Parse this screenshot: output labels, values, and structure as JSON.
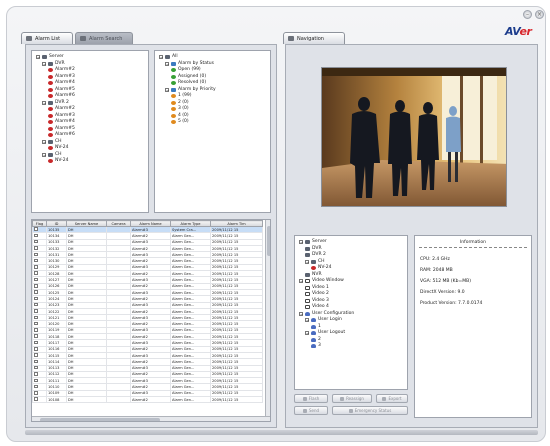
{
  "window": {
    "min_glyph": "–",
    "close_glyph": "×"
  },
  "brand": {
    "logo_a": "AV",
    "logo_b": "er"
  },
  "tabs": {
    "alarm_list": "Alarm List",
    "alarm_search": "Alarm Search",
    "navigation": "Navigation"
  },
  "alarm_tree": {
    "root": "Server",
    "nodes": [
      {
        "level": 1,
        "label": "DVR",
        "icon": "server-icon"
      },
      {
        "level": 2,
        "label": "Alarm#2",
        "icon": "alarm-icon"
      },
      {
        "level": 2,
        "label": "Alarm#3",
        "icon": "alarm-icon"
      },
      {
        "level": 2,
        "label": "Alarm#4",
        "icon": "alarm-icon"
      },
      {
        "level": 2,
        "label": "Alarm#5",
        "icon": "alarm-icon"
      },
      {
        "level": 2,
        "label": "Alarm#6",
        "icon": "alarm-icon"
      },
      {
        "level": 1,
        "label": "DVR 2",
        "icon": "server-icon"
      },
      {
        "level": 2,
        "label": "Alarm#2",
        "icon": "alarm-icon"
      },
      {
        "level": 2,
        "label": "Alarm#3",
        "icon": "alarm-icon"
      },
      {
        "level": 2,
        "label": "Alarm#4",
        "icon": "alarm-icon"
      },
      {
        "level": 2,
        "label": "Alarm#5",
        "icon": "alarm-icon"
      },
      {
        "level": 2,
        "label": "Alarm#6",
        "icon": "alarm-icon"
      },
      {
        "level": 1,
        "label": "CH",
        "icon": "server-icon"
      },
      {
        "level": 2,
        "label": "NV-24",
        "icon": "alarm-icon"
      },
      {
        "level": 1,
        "label": "CH",
        "icon": "server-icon"
      },
      {
        "level": 2,
        "label": "NV-24",
        "icon": "alarm-icon"
      }
    ]
  },
  "filter_tree": {
    "root": "All",
    "nodes": [
      {
        "level": 1,
        "label": "Alarm by Status",
        "icon": "group-icon"
      },
      {
        "level": 2,
        "label": "Open (99)",
        "icon": "status-icon"
      },
      {
        "level": 2,
        "label": "Assigned (0)",
        "icon": "status-icon"
      },
      {
        "level": 2,
        "label": "Resolved (0)",
        "icon": "status-icon"
      },
      {
        "level": 1,
        "label": "Alarm by Priority",
        "icon": "group-icon"
      },
      {
        "level": 2,
        "label": "1 (99)",
        "icon": "priority-icon"
      },
      {
        "level": 2,
        "label": "2 (0)",
        "icon": "priority-icon"
      },
      {
        "level": 2,
        "label": "3 (0)",
        "icon": "priority-icon"
      },
      {
        "level": 2,
        "label": "4 (0)",
        "icon": "priority-icon"
      },
      {
        "level": 2,
        "label": "5 (0)",
        "icon": "priority-icon"
      }
    ]
  },
  "alarm_table": {
    "columns": [
      "Flag",
      "ID",
      "Server Name",
      "Camera",
      "Alarm Name",
      "Alarm Type",
      "Alarm Tim"
    ],
    "rows": [
      [
        "",
        "10135",
        "DH",
        "",
        "Alarm#3",
        "System Cra...",
        "2009/11/12 15"
      ],
      [
        "",
        "10134",
        "DH",
        "",
        "Alarm#2",
        "Alarm Gen...",
        "2009/11/12 15"
      ],
      [
        "",
        "10133",
        "DH",
        "",
        "Alarm#3",
        "Alarm Gen...",
        "2009/11/12 15"
      ],
      [
        "",
        "10132",
        "DH",
        "",
        "Alarm#2",
        "Alarm Gen...",
        "2009/11/12 15"
      ],
      [
        "",
        "10131",
        "DH",
        "",
        "Alarm#3",
        "Alarm Gen...",
        "2009/11/12 15"
      ],
      [
        "",
        "10130",
        "DH",
        "",
        "Alarm#2",
        "Alarm Gen...",
        "2009/11/12 15"
      ],
      [
        "",
        "10129",
        "DH",
        "",
        "Alarm#3",
        "Alarm Gen...",
        "2009/11/12 15"
      ],
      [
        "",
        "10128",
        "DH",
        "",
        "Alarm#2",
        "Alarm Gen...",
        "2009/11/12 15"
      ],
      [
        "",
        "10127",
        "DH",
        "",
        "Alarm#3",
        "Alarm Gen...",
        "2009/11/12 15"
      ],
      [
        "",
        "10126",
        "DH",
        "",
        "Alarm#2",
        "Alarm Gen...",
        "2009/11/12 15"
      ],
      [
        "",
        "10125",
        "DH",
        "",
        "Alarm#3",
        "Alarm Gen...",
        "2009/11/12 15"
      ],
      [
        "",
        "10124",
        "DH",
        "",
        "Alarm#2",
        "Alarm Gen...",
        "2009/11/12 15"
      ],
      [
        "",
        "10123",
        "DH",
        "",
        "Alarm#3",
        "Alarm Gen...",
        "2009/11/12 15"
      ],
      [
        "",
        "10122",
        "DH",
        "",
        "Alarm#2",
        "Alarm Gen...",
        "2009/11/12 15"
      ],
      [
        "",
        "10121",
        "DH",
        "",
        "Alarm#3",
        "Alarm Gen...",
        "2009/11/12 15"
      ],
      [
        "",
        "10120",
        "DH",
        "",
        "Alarm#2",
        "Alarm Gen...",
        "2009/11/12 15"
      ],
      [
        "",
        "10119",
        "DH",
        "",
        "Alarm#3",
        "Alarm Gen...",
        "2009/11/12 15"
      ],
      [
        "",
        "10118",
        "DH",
        "",
        "Alarm#2",
        "Alarm Gen...",
        "2009/11/12 15"
      ],
      [
        "",
        "10117",
        "DH",
        "",
        "Alarm#3",
        "Alarm Gen...",
        "2009/11/12 15"
      ],
      [
        "",
        "10116",
        "DH",
        "",
        "Alarm#2",
        "Alarm Gen...",
        "2009/11/12 15"
      ],
      [
        "",
        "10115",
        "DH",
        "",
        "Alarm#3",
        "Alarm Gen...",
        "2009/11/12 15"
      ],
      [
        "",
        "10114",
        "DH",
        "",
        "Alarm#2",
        "Alarm Gen...",
        "2009/11/12 15"
      ],
      [
        "",
        "10113",
        "DH",
        "",
        "Alarm#3",
        "Alarm Gen...",
        "2009/11/12 15"
      ],
      [
        "",
        "10112",
        "DH",
        "",
        "Alarm#2",
        "Alarm Gen...",
        "2009/11/12 15"
      ],
      [
        "",
        "10111",
        "DH",
        "",
        "Alarm#3",
        "Alarm Gen...",
        "2009/11/12 15"
      ],
      [
        "",
        "10110",
        "DH",
        "",
        "Alarm#2",
        "Alarm Gen...",
        "2009/11/12 15"
      ],
      [
        "",
        "10109",
        "DH",
        "",
        "Alarm#3",
        "Alarm Gen...",
        "2009/11/12 15"
      ],
      [
        "",
        "10108",
        "DH",
        "",
        "Alarm#2",
        "Alarm Gen...",
        "2009/11/12 15"
      ]
    ]
  },
  "nav_tree": {
    "nodes": [
      {
        "level": 0,
        "label": "Server",
        "icon": "server-icon"
      },
      {
        "level": 1,
        "label": "DVR",
        "icon": "server-icon"
      },
      {
        "level": 1,
        "label": "DVR 2",
        "icon": "server-icon"
      },
      {
        "level": 1,
        "label": "CH",
        "icon": "server-icon"
      },
      {
        "level": 2,
        "label": "NV-24",
        "icon": "alarm-icon"
      },
      {
        "level": 1,
        "label": "NVR",
        "icon": "server-icon"
      },
      {
        "level": 0,
        "label": "Video Window",
        "icon": "window-icon"
      },
      {
        "level": 1,
        "label": "Video 1",
        "icon": "window-icon"
      },
      {
        "level": 1,
        "label": "Video 2",
        "icon": "window-icon"
      },
      {
        "level": 1,
        "label": "Video 3",
        "icon": "window-icon"
      },
      {
        "level": 1,
        "label": "Video 4",
        "icon": "window-icon"
      },
      {
        "level": 0,
        "label": "User Configuration",
        "icon": "user-icon"
      },
      {
        "level": 1,
        "label": "User Login",
        "icon": "user-icon"
      },
      {
        "level": 2,
        "label": "1",
        "icon": "user-icon"
      },
      {
        "level": 1,
        "label": "User Logout",
        "icon": "user-icon"
      },
      {
        "level": 2,
        "label": "2",
        "icon": "user-icon"
      },
      {
        "level": 2,
        "label": "3",
        "icon": "user-icon"
      }
    ]
  },
  "info": {
    "title": "Information",
    "rule": "==================================",
    "lines": [
      "CPU: 2.4 GHz",
      "RAM: 2048 MB",
      "VGA: 512 MB (Kb=MB)",
      "DirectX Version: 9.0",
      "Product Version: 7.7.0.0174"
    ]
  },
  "actions": {
    "row1": [
      "Flash",
      "Reassign",
      "Export"
    ],
    "row2": [
      "Send",
      "Emergency Status"
    ]
  }
}
